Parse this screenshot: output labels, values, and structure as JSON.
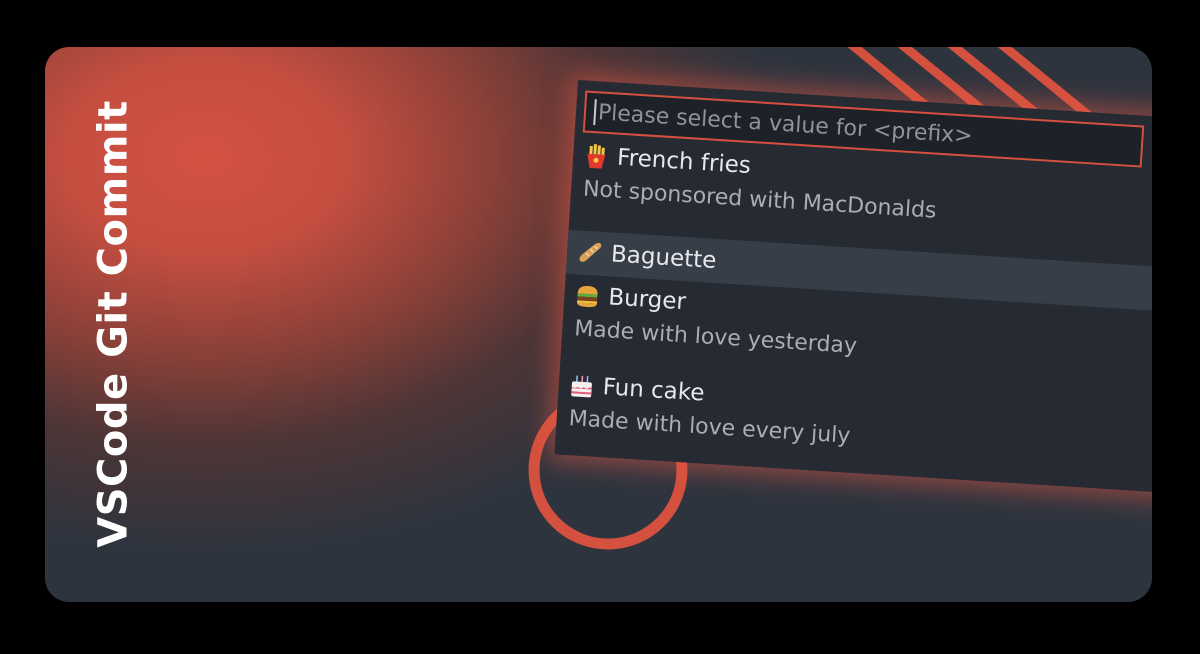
{
  "banner": {
    "title": "VSCode Git Commit"
  },
  "colors": {
    "accent": "#d4513f",
    "panel_bg": "#262b33",
    "selected_bg": "#373e48",
    "text_primary": "#e6e8ec",
    "text_secondary": "#a9adb5"
  },
  "picker": {
    "search": {
      "placeholder": "Please select a value for <prefix>",
      "value": ""
    },
    "items": [
      {
        "icon": "french-fries-emoji",
        "label": "French fries",
        "description": "Not sponsored with MacDonalds",
        "selected": false
      },
      {
        "icon": "baguette-emoji",
        "label": "Baguette",
        "description": "",
        "selected": true
      },
      {
        "icon": "burger-emoji",
        "label": "Burger",
        "description": "Made with love yesterday",
        "selected": false
      },
      {
        "icon": "birthday-cake-emoji",
        "label": "Fun cake",
        "description": "Made with love every july",
        "selected": false
      }
    ]
  }
}
